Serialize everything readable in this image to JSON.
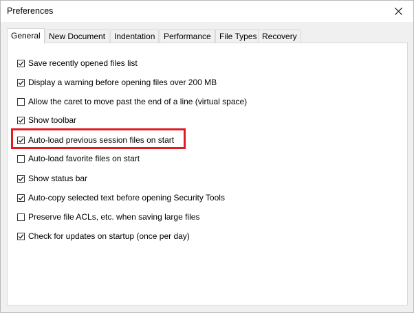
{
  "window": {
    "title": "Preferences"
  },
  "tabs": [
    {
      "label": "General",
      "active": true
    },
    {
      "label": "New Document",
      "active": false
    },
    {
      "label": "Indentation",
      "active": false
    },
    {
      "label": "Performance",
      "active": false
    },
    {
      "label": "File Types",
      "active": false
    },
    {
      "label": "Recovery",
      "active": false
    }
  ],
  "options": [
    {
      "label": "Save recently opened files list",
      "checked": true
    },
    {
      "label": "Display a warning before opening files over 200 MB",
      "checked": true
    },
    {
      "label": "Allow the caret to move past the end of a line (virtual space)",
      "checked": false
    },
    {
      "label": "Show toolbar",
      "checked": true
    },
    {
      "label": "Auto-load previous session files on start",
      "checked": true
    },
    {
      "label": "Auto-load favorite files on start",
      "checked": false
    },
    {
      "label": "Show status bar",
      "checked": true
    },
    {
      "label": "Auto-copy selected text before opening Security Tools",
      "checked": true
    },
    {
      "label": "Preserve file ACLs, etc. when saving large files",
      "checked": false
    },
    {
      "label": "Check for updates on startup (once per day)",
      "checked": true
    }
  ],
  "icons": {
    "close": "close-icon",
    "check": "checkmark-icon"
  },
  "colors": {
    "highlight": "#e01b24",
    "panel": "#ffffff",
    "chrome": "#f0f0f0"
  }
}
